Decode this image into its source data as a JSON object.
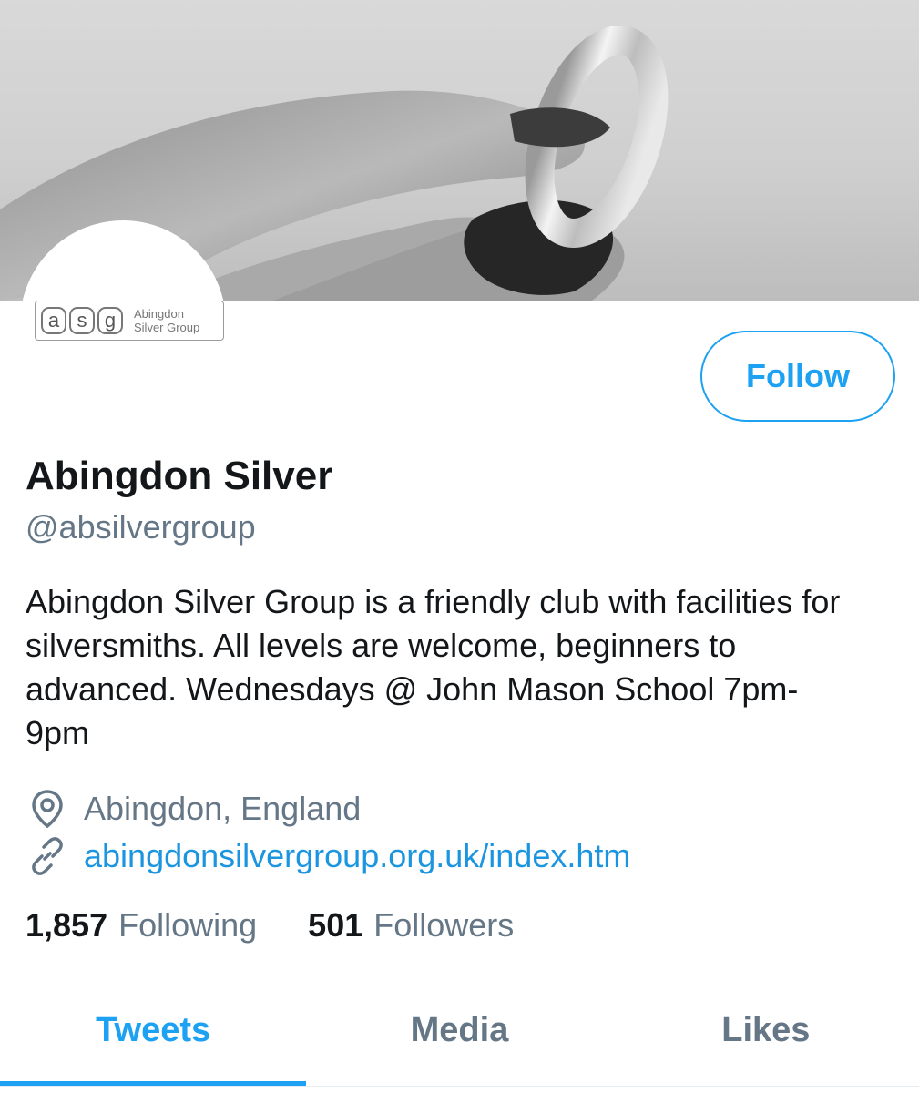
{
  "profile": {
    "logo_letters": [
      "a",
      "s",
      "g"
    ],
    "logo_line1": "Abingdon",
    "logo_line2": "Silver Group",
    "display_name": "Abingdon Silver",
    "handle": "@absilvergroup",
    "bio": "Abingdon Silver Group is a friendly club with facilities for silversmiths. All levels are welcome, beginners to advanced. Wednesdays @ John Mason School 7pm-9pm",
    "location": "Abingdon, England",
    "website": "abingdonsilvergroup.org.uk/index.htm",
    "follow_label": "Follow"
  },
  "stats": {
    "following_count": "1,857",
    "following_label": "Following",
    "followers_count": "501",
    "followers_label": "Followers"
  },
  "tabs": [
    {
      "label": "Tweets",
      "active": true
    },
    {
      "label": "Media",
      "active": false
    },
    {
      "label": "Likes",
      "active": false
    }
  ],
  "icons": {
    "location": "location-pin-icon",
    "link": "link-icon"
  },
  "colors": {
    "accent": "#1da1f2",
    "link": "#1b95e0",
    "secondary_text": "#657786",
    "primary_text": "#14171a"
  }
}
